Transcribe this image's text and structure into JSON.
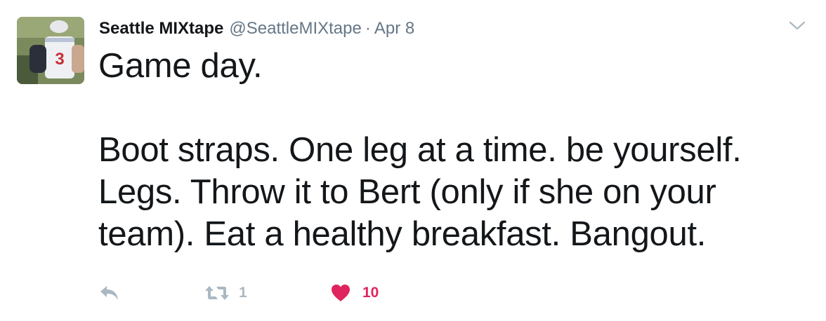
{
  "author": {
    "name": "Seattle MIXtape",
    "handle": "@SeattleMIXtape",
    "separator": "·",
    "date": "Apr 8",
    "avatar_icon": "player-photo-avatar"
  },
  "tweet": {
    "lines": [
      "Game day.",
      "",
      "Boot straps. One leg at a time. be yourself.",
      "Legs. Throw it to Bert (only if she on your",
      "team). Eat a healthy breakfast. Bangout."
    ]
  },
  "actions": {
    "reply_icon": "reply-icon",
    "retweet_icon": "retweet-icon",
    "retweet_count": "1",
    "like_icon": "heart-icon",
    "like_count": "10",
    "more_icon": "chevron-down-icon"
  },
  "colors": {
    "text": "#14171a",
    "secondary": "#657786",
    "icon": "#aab8c2",
    "like": "#e0245e"
  }
}
